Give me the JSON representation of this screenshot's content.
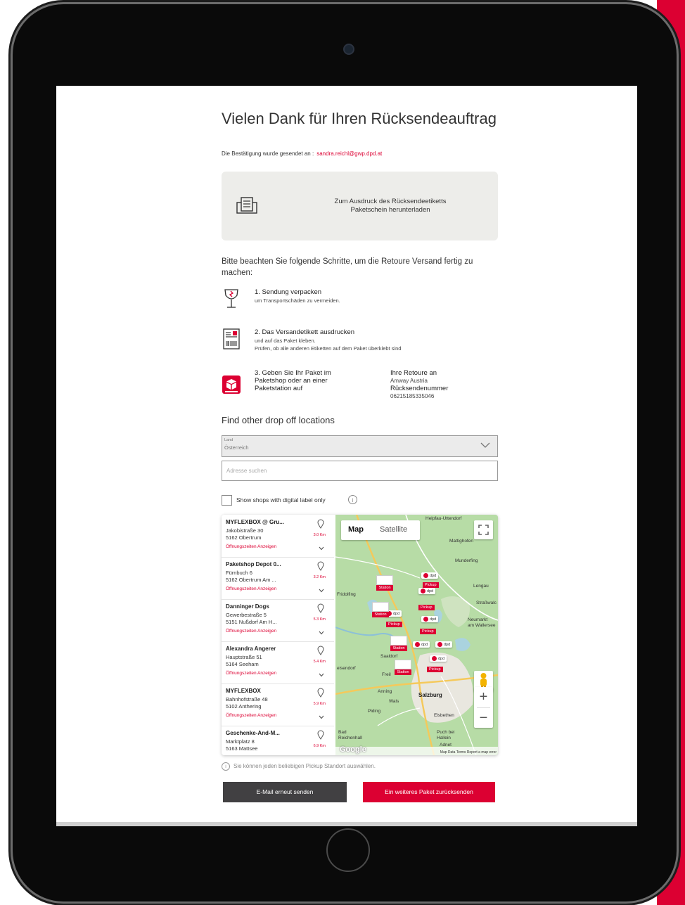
{
  "page": {
    "title": "Vielen Dank für Ihren Rücksendeauftrag",
    "confirmation_prefix": "Die Bestätigung wurde gesendet an :",
    "confirmation_email": "sandra.reichl@gwp.dpd.at"
  },
  "download": {
    "line1": "Zum Ausdruck des Rücksendeetiketts",
    "line2": "Paketschein herunterladen"
  },
  "steps": {
    "heading": "Bitte beachten Sie folgende Schritte, um die Retoure Versand fertig zu machen:",
    "step1": {
      "title": "1. Sendung verpacken",
      "line1": "um Transportschäden zu vermeiden."
    },
    "step2": {
      "title": "2. Das Versandetikett ausdrucken",
      "line1": "und auf das Paket kleben.",
      "line2": "Prüfen, ob alle anderen Etiketten auf dem Paket überklebt sind"
    },
    "step3": {
      "title": "3. Geben Sie Ihr Paket im Paketshop oder an einer Paketstation auf"
    },
    "retoure": {
      "heading": "Ihre Retoure an",
      "company": "Amway Austria",
      "number_label": "Rücksendenummer",
      "number": "06215185335046"
    }
  },
  "finder": {
    "heading": "Find other drop off locations",
    "land_label": "Land",
    "land_value": "Österreich",
    "search_placeholder": "Adresse suchen",
    "digital_label": "Show shops with digital label only",
    "info_glyph": "i"
  },
  "shops": [
    {
      "name": "MYFLEXBOX @ Gru...",
      "street": "Jakobistraße 30",
      "city": "5162 Obertrum",
      "hours": "Öffnungszeiten Anzeigen",
      "distance": "3.0 Km"
    },
    {
      "name": "Paketshop Depot 0...",
      "street": "Fürnbuch 6",
      "city": "5162 Obertrum Am ...",
      "hours": "Öffnungszeiten Anzeigen",
      "distance": "3.2 Km"
    },
    {
      "name": "Danninger Dogs",
      "street": "Gewerbestraße 5",
      "city": "5151 Nußdorf Am H...",
      "hours": "Öffnungszeiten Anzeigen",
      "distance": "5.3 Km"
    },
    {
      "name": "Alexandra Angerer",
      "street": "Hauptstraße 51",
      "city": "5164 Seeham",
      "hours": "Öffnungszeiten Anzeigen",
      "distance": "5.4 Km"
    },
    {
      "name": "MYFLEXBOX",
      "street": "Bahnhofstraße 48",
      "city": "5102 Anthering",
      "hours": "Öffnungszeiten Anzeigen",
      "distance": "5.9 Km"
    },
    {
      "name": "Geschenke-And-M...",
      "street": "Marktplatz 8",
      "city": "5163 Mattsee",
      "hours": "",
      "distance": "6.9 Km"
    }
  ],
  "map": {
    "toggle_map": "Map",
    "toggle_satellite": "Satellite",
    "zoom_in": "+",
    "zoom_out": "−",
    "google": "Google",
    "attribution": "Map Data   Terms   Report a map error",
    "places": {
      "helpfau": "Helpfau-Uttendorf",
      "mattighofen": "Mattighofen",
      "munderfing": "Munderfing",
      "lengau": "Lengau",
      "strasswalchen": "Straßwalc",
      "fridolfing": "Fridolfing",
      "neumarkt": "Neumarkt",
      "wallersee": "am Wallersee",
      "saaldorf": "Saaldorf",
      "freilassing": "Freil",
      "eisendorf": "eisendorf",
      "anning": "Anning",
      "wals": "Wals",
      "salzburg": "Salzburg",
      "piding": "Piding",
      "elsbethen": "Elsbethen",
      "bad_reichenhall": "Bad Reichenhall",
      "puch": "Puch bei Hallein",
      "adnet": "Adnet"
    },
    "marker_labels": {
      "dpd": "dpd",
      "station": "Station",
      "pickup": "Pickup"
    }
  },
  "hint": "Sie können jeden beliebigen Pickup Standort auswählen.",
  "hint_glyph": "i",
  "buttons": {
    "resend": "E-Mail erneut senden",
    "another": "Ein weiteres Paket zurücksenden"
  },
  "colors": {
    "brand": "#dc0032",
    "dark_button": "#414042",
    "download_bg": "#ededea"
  }
}
